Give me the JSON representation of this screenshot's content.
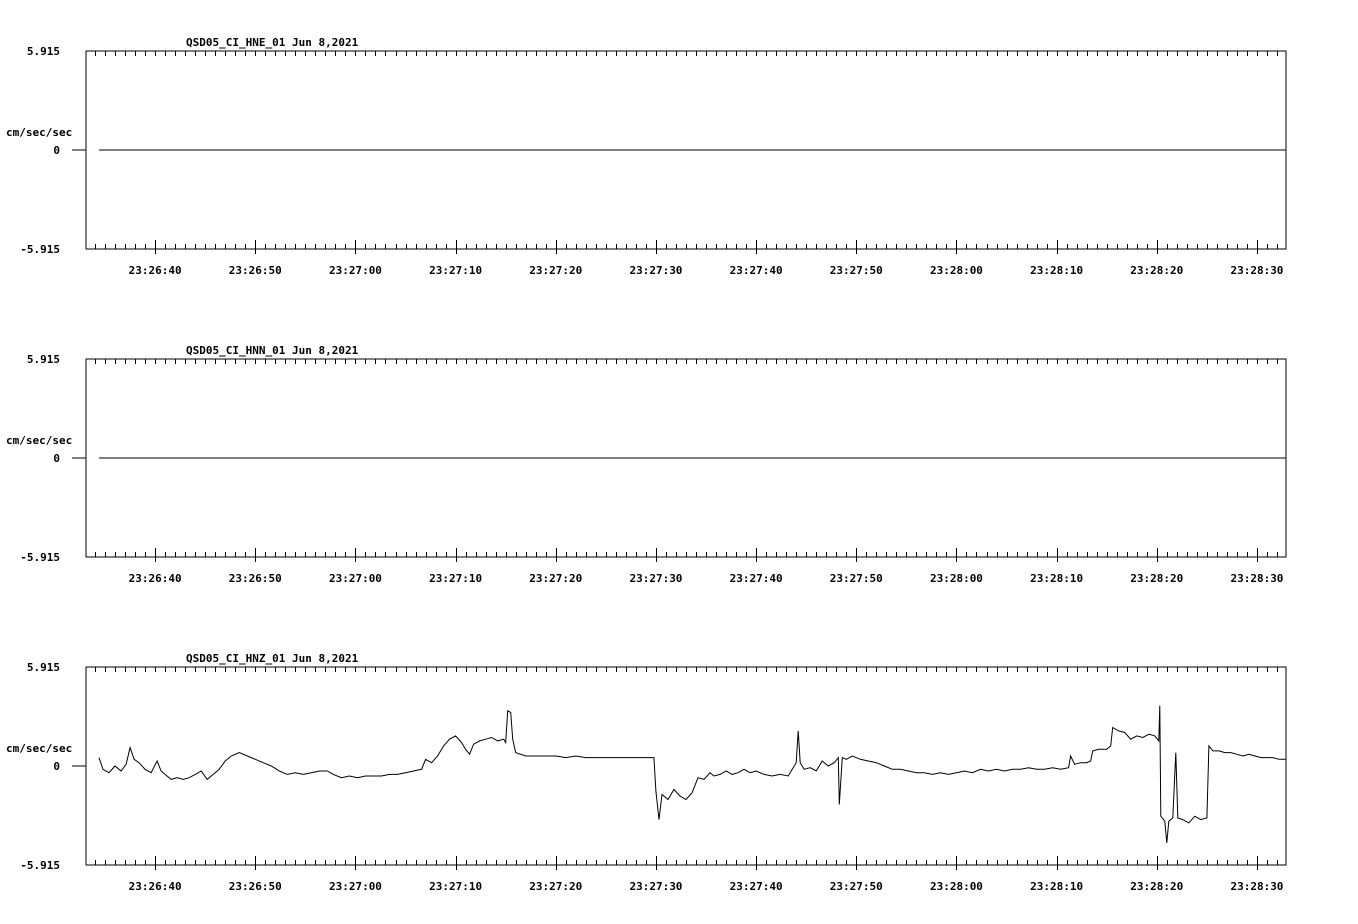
{
  "chart_data": [
    {
      "type": "line",
      "title": "QSD05_CI_HNE_01  Jun 8,2021",
      "ylabel": "cm/sec/sec",
      "ytick_labels": [
        "5.915",
        "0",
        "-5.915"
      ],
      "ylim": [
        -5.915,
        5.915
      ],
      "xtick_labels": [
        "23:26:40",
        "23:26:50",
        "23:27:00",
        "23:27:10",
        "23:27:20",
        "23:27:30",
        "23:27:40",
        "23:27:50",
        "23:28:00",
        "23:28:10",
        "23:28:20",
        "23:28:30"
      ],
      "xlim_seconds": [
        -6.9,
        112.9
      ],
      "trace": {
        "t_start": -5.6,
        "t_end": 112.9,
        "baseline": 0,
        "line_width": 2,
        "points": []
      }
    },
    {
      "type": "line",
      "title": "QSD05_CI_HNN_01  Jun 8,2021",
      "ylabel": "cm/sec/sec",
      "ytick_labels": [
        "5.915",
        "0",
        "-5.915"
      ],
      "ylim": [
        -5.915,
        5.915
      ],
      "xtick_labels": [
        "23:26:40",
        "23:26:50",
        "23:27:00",
        "23:27:10",
        "23:27:20",
        "23:27:30",
        "23:27:40",
        "23:27:50",
        "23:28:00",
        "23:28:10",
        "23:28:20",
        "23:28:30"
      ],
      "xlim_seconds": [
        -6.9,
        112.9
      ],
      "trace": {
        "t_start": -5.6,
        "t_end": 112.9,
        "baseline": 0,
        "line_width": 2,
        "points": []
      }
    },
    {
      "type": "line",
      "title": "QSD05_CI_HNZ_01  Jun 8,2021",
      "ylabel": "cm/sec/sec",
      "ytick_labels": [
        "5.915",
        "0",
        "-5.915"
      ],
      "ylim": [
        -5.915,
        5.915
      ],
      "xtick_labels": [
        "23:26:40",
        "23:26:50",
        "23:27:00",
        "23:27:10",
        "23:27:20",
        "23:27:30",
        "23:27:40",
        "23:27:50",
        "23:28:00",
        "23:28:10",
        "23:28:20",
        "23:28:30"
      ],
      "xlim_seconds": [
        -6.9,
        112.9
      ],
      "trace": {
        "t_start": -5.6,
        "t_end": 112.9,
        "baseline": null,
        "line_width": 1,
        "points": [
          [
            -5.6,
            0.5
          ],
          [
            -5.2,
            -0.2
          ],
          [
            -4.6,
            -0.4
          ],
          [
            -4.0,
            0.0
          ],
          [
            -3.4,
            -0.3
          ],
          [
            -2.9,
            0.1
          ],
          [
            -2.5,
            1.1
          ],
          [
            -2.1,
            0.4
          ],
          [
            -1.6,
            0.2
          ],
          [
            -1.0,
            -0.2
          ],
          [
            -0.4,
            -0.4
          ],
          [
            0.2,
            0.3
          ],
          [
            0.6,
            -0.3
          ],
          [
            1.0,
            -0.5
          ],
          [
            1.6,
            -0.8
          ],
          [
            2.2,
            -0.7
          ],
          [
            2.8,
            -0.8
          ],
          [
            3.4,
            -0.7
          ],
          [
            4.0,
            -0.5
          ],
          [
            4.6,
            -0.3
          ],
          [
            5.2,
            -0.8
          ],
          [
            5.8,
            -0.5
          ],
          [
            6.4,
            -0.2
          ],
          [
            7.0,
            0.3
          ],
          [
            7.6,
            0.6
          ],
          [
            8.4,
            0.8
          ],
          [
            9.2,
            0.6
          ],
          [
            10.0,
            0.4
          ],
          [
            10.8,
            0.2
          ],
          [
            11.6,
            0.0
          ],
          [
            12.4,
            -0.3
          ],
          [
            13.2,
            -0.5
          ],
          [
            14.0,
            -0.4
          ],
          [
            14.8,
            -0.5
          ],
          [
            15.6,
            -0.4
          ],
          [
            16.4,
            -0.3
          ],
          [
            17.2,
            -0.3
          ],
          [
            17.8,
            -0.5
          ],
          [
            18.6,
            -0.7
          ],
          [
            19.4,
            -0.6
          ],
          [
            20.2,
            -0.7
          ],
          [
            21.0,
            -0.6
          ],
          [
            21.8,
            -0.6
          ],
          [
            22.6,
            -0.6
          ],
          [
            23.4,
            -0.5
          ],
          [
            24.2,
            -0.5
          ],
          [
            25.0,
            -0.4
          ],
          [
            25.8,
            -0.3
          ],
          [
            26.6,
            -0.2
          ],
          [
            27.0,
            0.4
          ],
          [
            27.6,
            0.2
          ],
          [
            28.2,
            0.6
          ],
          [
            28.8,
            1.2
          ],
          [
            29.4,
            1.6
          ],
          [
            30.0,
            1.8
          ],
          [
            30.6,
            1.4
          ],
          [
            31.0,
            1.0
          ],
          [
            31.4,
            0.7
          ],
          [
            31.8,
            1.3
          ],
          [
            32.4,
            1.5
          ],
          [
            33.0,
            1.6
          ],
          [
            33.6,
            1.7
          ],
          [
            34.2,
            1.5
          ],
          [
            34.8,
            1.6
          ],
          [
            35.0,
            1.4
          ],
          [
            35.2,
            3.3
          ],
          [
            35.5,
            3.2
          ],
          [
            35.7,
            1.6
          ],
          [
            36.0,
            0.8
          ],
          [
            37.0,
            0.6
          ],
          [
            38.0,
            0.6
          ],
          [
            39.0,
            0.6
          ],
          [
            40.0,
            0.6
          ],
          [
            41.0,
            0.5
          ],
          [
            42.0,
            0.6
          ],
          [
            43.0,
            0.5
          ],
          [
            44.0,
            0.5
          ],
          [
            45.0,
            0.5
          ],
          [
            46.0,
            0.5
          ],
          [
            47.0,
            0.5
          ],
          [
            48.0,
            0.5
          ],
          [
            49.0,
            0.5
          ],
          [
            49.8,
            0.5
          ],
          [
            50.0,
            -1.5
          ],
          [
            50.3,
            -3.2
          ],
          [
            50.6,
            -1.7
          ],
          [
            51.2,
            -2.0
          ],
          [
            51.8,
            -1.4
          ],
          [
            52.4,
            -1.8
          ],
          [
            53.0,
            -2.0
          ],
          [
            53.6,
            -1.6
          ],
          [
            54.2,
            -0.7
          ],
          [
            54.8,
            -0.8
          ],
          [
            55.4,
            -0.4
          ],
          [
            55.8,
            -0.6
          ],
          [
            56.4,
            -0.5
          ],
          [
            57.0,
            -0.3
          ],
          [
            57.6,
            -0.5
          ],
          [
            58.2,
            -0.4
          ],
          [
            58.8,
            -0.2
          ],
          [
            59.4,
            -0.4
          ],
          [
            60.0,
            -0.3
          ],
          [
            60.8,
            -0.5
          ],
          [
            61.6,
            -0.6
          ],
          [
            62.4,
            -0.5
          ],
          [
            63.2,
            -0.6
          ],
          [
            64.0,
            0.2
          ],
          [
            64.2,
            2.1
          ],
          [
            64.4,
            0.2
          ],
          [
            64.8,
            -0.2
          ],
          [
            65.4,
            -0.1
          ],
          [
            66.0,
            -0.3
          ],
          [
            66.6,
            0.3
          ],
          [
            67.2,
            0.0
          ],
          [
            67.8,
            0.2
          ],
          [
            68.2,
            0.5
          ],
          [
            68.3,
            -2.3
          ],
          [
            68.6,
            0.5
          ],
          [
            69.0,
            0.4
          ],
          [
            69.6,
            0.6
          ],
          [
            70.4,
            0.4
          ],
          [
            71.2,
            0.3
          ],
          [
            72.0,
            0.2
          ],
          [
            72.8,
            0.0
          ],
          [
            73.6,
            -0.2
          ],
          [
            74.4,
            -0.2
          ],
          [
            75.2,
            -0.3
          ],
          [
            76.0,
            -0.4
          ],
          [
            76.8,
            -0.4
          ],
          [
            77.6,
            -0.5
          ],
          [
            78.4,
            -0.4
          ],
          [
            79.2,
            -0.5
          ],
          [
            80.0,
            -0.4
          ],
          [
            80.8,
            -0.3
          ],
          [
            81.6,
            -0.4
          ],
          [
            82.4,
            -0.2
          ],
          [
            83.2,
            -0.3
          ],
          [
            84.0,
            -0.2
          ],
          [
            84.8,
            -0.3
          ],
          [
            85.6,
            -0.2
          ],
          [
            86.4,
            -0.2
          ],
          [
            87.2,
            -0.1
          ],
          [
            88.0,
            -0.2
          ],
          [
            88.8,
            -0.2
          ],
          [
            89.6,
            -0.1
          ],
          [
            90.4,
            -0.2
          ],
          [
            91.2,
            -0.1
          ],
          [
            91.4,
            0.6
          ],
          [
            91.8,
            0.1
          ],
          [
            92.4,
            0.2
          ],
          [
            93.0,
            0.2
          ],
          [
            93.4,
            0.3
          ],
          [
            93.6,
            0.9
          ],
          [
            94.2,
            1.0
          ],
          [
            95.0,
            1.0
          ],
          [
            95.4,
            1.2
          ],
          [
            95.6,
            2.3
          ],
          [
            96.2,
            2.1
          ],
          [
            96.8,
            2.0
          ],
          [
            97.4,
            1.6
          ],
          [
            98.0,
            1.8
          ],
          [
            98.6,
            1.7
          ],
          [
            99.2,
            1.9
          ],
          [
            99.8,
            1.8
          ],
          [
            100.2,
            1.5
          ],
          [
            100.3,
            3.6
          ],
          [
            100.4,
            -3.0
          ],
          [
            100.8,
            -3.3
          ],
          [
            101.0,
            -4.6
          ],
          [
            101.2,
            -3.3
          ],
          [
            101.6,
            -3.1
          ],
          [
            101.9,
            0.8
          ],
          [
            102.1,
            -3.1
          ],
          [
            102.6,
            -3.2
          ],
          [
            103.2,
            -3.4
          ],
          [
            103.8,
            -3.0
          ],
          [
            104.4,
            -3.2
          ],
          [
            105.0,
            -3.1
          ],
          [
            105.2,
            1.2
          ],
          [
            105.6,
            0.9
          ],
          [
            106.2,
            0.9
          ],
          [
            106.8,
            0.8
          ],
          [
            107.4,
            0.8
          ],
          [
            108.0,
            0.7
          ],
          [
            108.6,
            0.6
          ],
          [
            109.2,
            0.7
          ],
          [
            109.8,
            0.6
          ],
          [
            110.4,
            0.5
          ],
          [
            111.0,
            0.5
          ],
          [
            111.6,
            0.5
          ],
          [
            112.2,
            0.4
          ],
          [
            112.9,
            0.4
          ]
        ]
      }
    }
  ]
}
